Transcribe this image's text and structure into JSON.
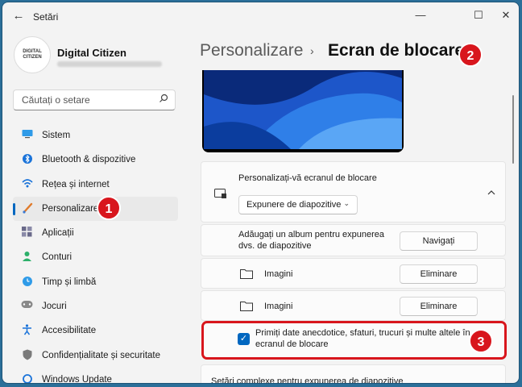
{
  "window": {
    "title": "Setări",
    "back": "←",
    "minimize": "—",
    "maximize": "☐",
    "close": "✕"
  },
  "user": {
    "avatar_line1": "DIGITAL",
    "avatar_line2": "CITIZEN",
    "name": "Digital Citizen"
  },
  "search": {
    "placeholder": "Căutați o setare"
  },
  "sidebar": {
    "items": [
      {
        "label": "Sistem",
        "icon": "monitor-icon"
      },
      {
        "label": "Bluetooth & dispozitive",
        "icon": "bluetooth-icon"
      },
      {
        "label": "Rețea și internet",
        "icon": "wifi-icon"
      },
      {
        "label": "Personalizare",
        "icon": "brush-icon",
        "active": true
      },
      {
        "label": "Aplicații",
        "icon": "apps-icon"
      },
      {
        "label": "Conturi",
        "icon": "person-icon"
      },
      {
        "label": "Timp și limbă",
        "icon": "globe-clock-icon"
      },
      {
        "label": "Jocuri",
        "icon": "gamepad-icon"
      },
      {
        "label": "Accesibilitate",
        "icon": "accessibility-icon"
      },
      {
        "label": "Confidențialitate și securitate",
        "icon": "shield-icon"
      },
      {
        "label": "Windows Update",
        "icon": "update-icon"
      }
    ]
  },
  "breadcrumb": {
    "parent": "Personalizare",
    "separator": "›",
    "current": "Ecran de blocare"
  },
  "badges": {
    "one": "1",
    "two": "2",
    "three": "3"
  },
  "lockscreen": {
    "title": "Personalizați-vă ecranul de blocare",
    "dropdown_value": "Expunere de diapozitive",
    "add_album_label_1": "Adăugați un album pentru expunerea",
    "add_album_label_2": "dvs. de diapozitive",
    "browse_button": "Navigați",
    "albums": [
      {
        "name": "Imagini",
        "remove": "Eliminare"
      },
      {
        "name": "Imagini",
        "remove": "Eliminare"
      }
    ],
    "fun_facts_label_1": "Primiți date anecdotice, sfaturi, trucuri și multe altele în",
    "fun_facts_label_2": "ecranul de blocare",
    "fun_facts_checked": true,
    "advanced_title": "Setări complexe pentru expunerea de diapozitive"
  },
  "colors": {
    "accent": "#0067c0",
    "badge": "#d8161d",
    "desktop": "#2b6f99"
  }
}
